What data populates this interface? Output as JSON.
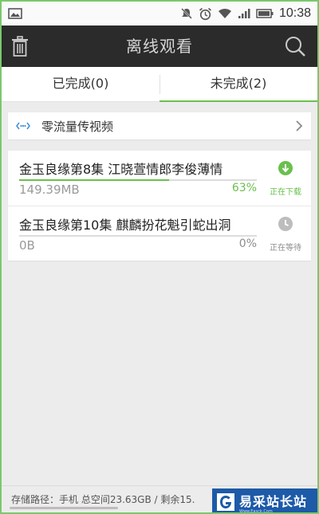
{
  "status_bar": {
    "time": "10:38",
    "icons": [
      "screenshot-icon",
      "mute-icon",
      "alarm-icon",
      "wifi-icon",
      "signal-icon",
      "battery-icon"
    ]
  },
  "header": {
    "title": "离线观看",
    "left_icon": "trash-icon",
    "right_icon": "search-icon"
  },
  "tabs": [
    {
      "label": "已完成(0)",
      "active": false
    },
    {
      "label": "未完成(2)",
      "active": true
    }
  ],
  "zero_traffic": {
    "label": "零流量传视频"
  },
  "downloads": [
    {
      "title": "金玉良缘第8集  江晓萱情郎李俊薄情",
      "size": "149.39MB",
      "percent_label": "63%",
      "progress": 0.63,
      "status": "正在下载",
      "status_color": "#6ac04d",
      "percent_color": "#6ac04d"
    },
    {
      "title": "金玉良缘第10集  麒麟扮花魁引蛇出洞",
      "size": "0B",
      "percent_label": "0%",
      "progress": 0,
      "status": "正在等待",
      "status_color": "#8d8d8d",
      "percent_color": "#8d8d8d"
    }
  ],
  "footer": {
    "path_text": "存储路径：手机 总空间23.63GB / 剩余15."
  },
  "watermark": {
    "text": "易采站长站",
    "subtext": "Www.Easck.Com"
  },
  "colors": {
    "accent_green": "#6ac04d",
    "titlebar_bg": "#2b2b2b",
    "watermark_bg": "#1d5aa8"
  }
}
